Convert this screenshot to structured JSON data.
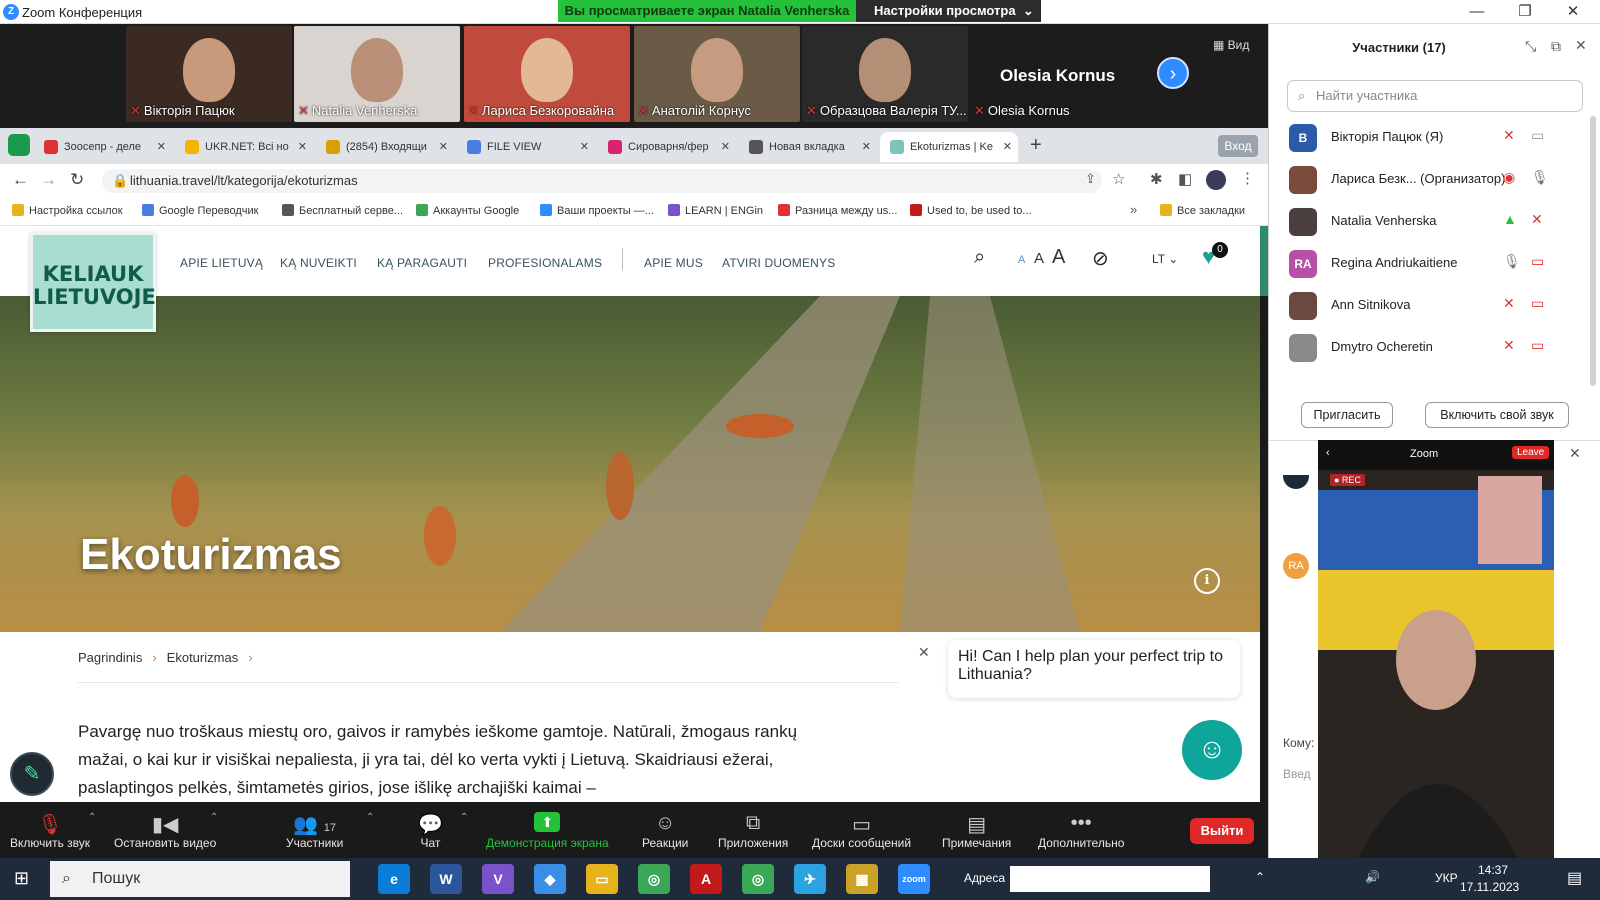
{
  "window": {
    "title": "Zoom Конференция",
    "banner": "Вы просматриваете экран Natalia Venherska",
    "view_settings": "Настройки просмотра",
    "minimize": "—",
    "restore": "❐",
    "close": "✕"
  },
  "strip": {
    "tiles": [
      {
        "name": "Вікторія Пацюк",
        "bg": "#3b2a22",
        "face": "#c89a7c"
      },
      {
        "name": "Natalia Venherska",
        "bg": "#d9d4cf",
        "face": "#b98f78"
      },
      {
        "name": "Лариса Безкоровайна",
        "bg": "#c04b3c",
        "face": "#e2b896"
      },
      {
        "name": "Анатолій Корнус",
        "bg": "#6a5a46",
        "face": "#c69c80"
      },
      {
        "name": "Образцова Валерія ТУ...",
        "bg": "#2a2a2a",
        "face": "#b48f76"
      }
    ],
    "active_name": "Olesia Kornus",
    "last_tile_label": "Olesia Kornus",
    "view_label": "Вид"
  },
  "browser": {
    "tabs": [
      {
        "label": "Зоосепр - деле",
        "color": "#e03232"
      },
      {
        "label": "UKR.NET: Всі но",
        "color": "#f5b400"
      },
      {
        "label": "(2854) Входящи",
        "color": "#d8a000"
      },
      {
        "label": "FILE VIEW",
        "color": "#4a7de0"
      },
      {
        "label": "Сироварня/фер",
        "color": "#d6246e"
      },
      {
        "label": "Новая вкладка",
        "color": "#555"
      },
      {
        "label": "Ekoturizmas | Ke",
        "color": "#7cc4b8"
      }
    ],
    "login": "Вход",
    "url": "lithuania.travel/lt/kategorija/ekoturizmas",
    "bookmarks": [
      "Настройка ссылок",
      "Google Переводчик",
      "Бесплатный серве...",
      "Аккаунты Google",
      "Ваши проекты —...",
      "LEARN | ENGin",
      "Разница между us...",
      "Used to, be used to..."
    ],
    "all_bookmarks": "Все закладки"
  },
  "site": {
    "logo_line1": "KELIAUK",
    "logo_line2": "LIETUVOJE",
    "nav": [
      "APIE LIETUVĄ",
      "KĄ NUVEIKTI",
      "KĄ PARAGAUTI",
      "PROFESIONALAMS",
      "APIE MUS",
      "ATVIRI DUOMENYS"
    ],
    "lang": "LT ⌄",
    "fav_count": "0",
    "font_sizes": [
      "A",
      "A",
      "A"
    ],
    "hero_title": "Ekoturizmas",
    "crumbs": [
      "Pagrindinis",
      "Ekoturizmas"
    ],
    "paragraph": "Pavargę nuo troškaus miestų oro, gaivos ir ramybės ieškome gamtoje. Natūrali, žmogaus rankų mažai, o kai kur ir visiškai nepaliesta, ji yra tai, dėl ko verta vykti į Lietuvą. Skaidriausi ežerai, paslaptingos pelkės, šimtametės girios, jose išlikę archajiški kaimai –",
    "chat_text": "Hi! Can I help plan your perfect trip to Lithuania?"
  },
  "toolbar": {
    "items": [
      {
        "label": "Включить звук",
        "glyph": "🎙"
      },
      {
        "label": "Остановить видео",
        "glyph": "▮◀"
      },
      {
        "label": "Участники",
        "glyph": "👥",
        "count": "17"
      },
      {
        "label": "Чат",
        "glyph": "💬"
      },
      {
        "label": "Демонстрация экрана",
        "glyph": "⬆"
      },
      {
        "label": "Реакции",
        "glyph": "☺"
      },
      {
        "label": "Приложения",
        "glyph": "⧉"
      },
      {
        "label": "Доски сообщений",
        "glyph": "▭"
      },
      {
        "label": "Примечания",
        "glyph": "▤"
      },
      {
        "label": "Дополнительно",
        "glyph": "•••"
      }
    ],
    "leave": "Выйти"
  },
  "participants": {
    "title": "Участники (17)",
    "search_placeholder": "Найти участника",
    "list": [
      {
        "initials": "В",
        "name": "Вікторія Пацюк (Я)",
        "color": "#2a5aa8"
      },
      {
        "initials": "",
        "name": "Лариса Безк... (Организатор)",
        "color": "#7a4a3a"
      },
      {
        "initials": "",
        "name": "Natalia Venherska",
        "color": "#4a4040"
      },
      {
        "initials": "RA",
        "name": "Regina Andriukaitiene",
        "color": "#b84fa8"
      },
      {
        "initials": "",
        "name": "Ann Sitnikova",
        "color": "#6a4a40"
      },
      {
        "initials": "",
        "name": "Dmytro Ocheretin",
        "color": "#8a8a8a"
      }
    ],
    "invite": "Пригласить",
    "unmute_self": "Включить свой звук"
  },
  "chat_panel": {
    "to_label": "Кому:",
    "input_hint": "Введ",
    "avatar_ra": "RA"
  },
  "phone": {
    "app": "Zoom",
    "leave": "Leave",
    "rec": "● REC"
  },
  "taskbar": {
    "search": "Пошук",
    "address_label": "Адреса",
    "lang": "УКР",
    "time": "14:37",
    "date": "17.11.2023",
    "apps": [
      {
        "label": "e",
        "color": "#0a7bd6"
      },
      {
        "label": "W",
        "color": "#2b579a"
      },
      {
        "label": "V",
        "color": "#7a52c9"
      },
      {
        "label": "◆",
        "color": "#3a8ee6"
      },
      {
        "label": "▭",
        "color": "#e8b21a"
      },
      {
        "label": "◎",
        "color": "#3aa757"
      },
      {
        "label": "A",
        "color": "#c21a1a"
      },
      {
        "label": "◎",
        "color": "#3aa757"
      },
      {
        "label": "✈",
        "color": "#2aa3e0"
      },
      {
        "label": "▦",
        "color": "#c9a227"
      },
      {
        "label": "zoom",
        "color": "#2d8cff"
      }
    ]
  }
}
